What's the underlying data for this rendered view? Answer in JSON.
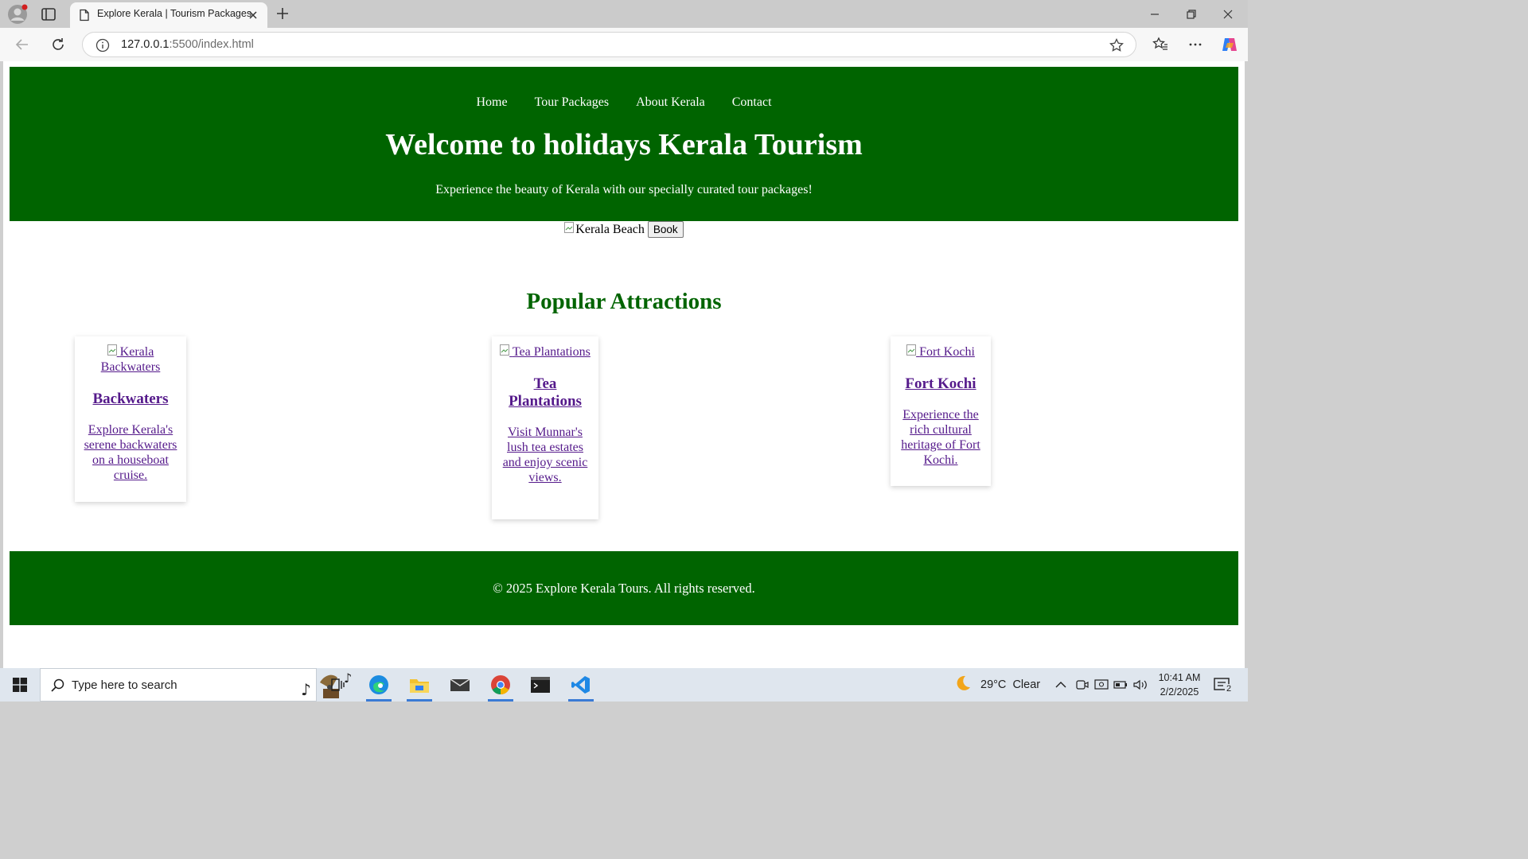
{
  "browser": {
    "tab_title": "Explore Kerala | Tourism Packages",
    "url_host": "127.0.0.1",
    "url_rest": ":5500/index.html"
  },
  "site": {
    "nav": [
      "Home",
      "Tour Packages",
      "About Kerala",
      "Contact"
    ],
    "heading": "Welcome to holidays Kerala Tourism",
    "tagline": "Experience the beauty of Kerala with our specially curated tour packages!",
    "hero_alt": "Kerala Beach",
    "book_label": "Book",
    "attractions_title": "Popular Attractions",
    "attractions": [
      {
        "img_alt": "Kerala Backwaters",
        "title": "Backwaters",
        "desc": "Explore Kerala's serene backwaters on a houseboat cruise."
      },
      {
        "img_alt": "Tea Plantations",
        "title": "Tea Plantations",
        "desc": "Visit Munnar's lush tea estates and enjoy scenic views."
      },
      {
        "img_alt": "Fort Kochi",
        "title": "Fort Kochi",
        "desc": "Experience the rich cultural heritage of Fort Kochi."
      }
    ],
    "footer": "© 2025 Explore Kerala Tours. All rights reserved."
  },
  "taskbar": {
    "search_placeholder": "Type here to search",
    "weather": "29°C  Clear",
    "time": "10:41 AM",
    "date": "2/2/2025",
    "notification_count": "2"
  },
  "colors": {
    "brand_green": "#006400",
    "visited_link": "#551a8b"
  }
}
